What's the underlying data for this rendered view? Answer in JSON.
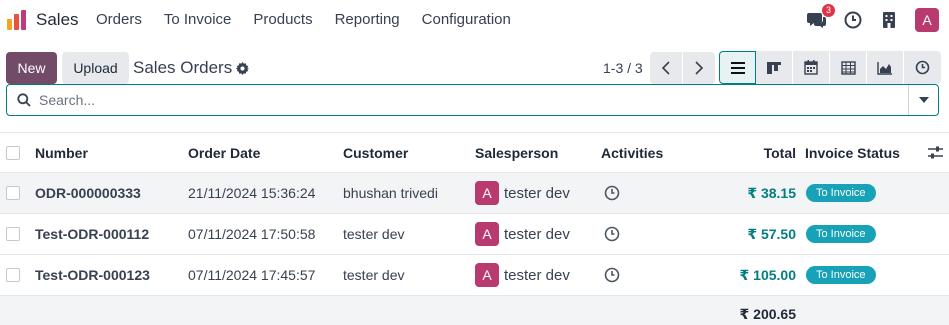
{
  "navbar": {
    "brand": "Sales",
    "menu": [
      "Orders",
      "To Invoice",
      "Products",
      "Reporting",
      "Configuration"
    ],
    "messages_count": "3",
    "user_initial": "A"
  },
  "control_panel": {
    "new_label": "New",
    "upload_label": "Upload",
    "title": "Sales Orders",
    "pager": "1-3 / 3",
    "views": [
      "list",
      "kanban",
      "calendar",
      "pivot",
      "graph",
      "activity"
    ]
  },
  "search": {
    "placeholder": "Search..."
  },
  "table": {
    "headers": {
      "number": "Number",
      "order_date": "Order Date",
      "customer": "Customer",
      "salesperson": "Salesperson",
      "activities": "Activities",
      "total": "Total",
      "invoice_status": "Invoice Status"
    },
    "rows": [
      {
        "number": "ODR-000000333",
        "order_date": "21/11/2024 15:36:24",
        "customer": "bhushan trivedi",
        "salesperson_initial": "A",
        "salesperson": "tester dev",
        "total": "₹ 38.15",
        "invoice_status": "To Invoice"
      },
      {
        "number": "Test-ODR-000112",
        "order_date": "07/11/2024 17:50:58",
        "customer": "tester dev",
        "salesperson_initial": "A",
        "salesperson": "tester dev",
        "total": "₹ 57.50",
        "invoice_status": "To Invoice"
      },
      {
        "number": "Test-ODR-000123",
        "order_date": "07/11/2024 17:45:57",
        "customer": "tester dev",
        "salesperson_initial": "A",
        "salesperson": "tester dev",
        "total": "₹ 105.00",
        "invoice_status": "To Invoice"
      }
    ],
    "grand_total": "₹ 200.65"
  },
  "colors": {
    "brand_primary": "#714b67",
    "accent_teal": "#017e84",
    "avatar_bg": "#b83a6e",
    "badge_info": "#17a2b8"
  }
}
